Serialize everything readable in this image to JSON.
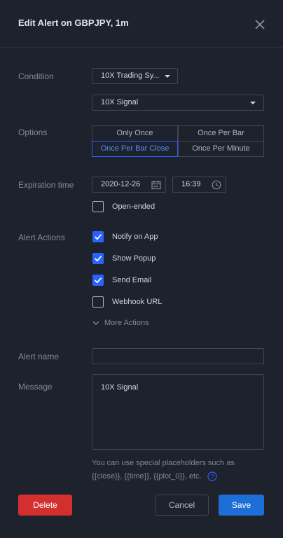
{
  "title": "Edit Alert on GBPJPY, 1m",
  "condition": {
    "label": "Condition",
    "indicator": "10X Trading Sy...",
    "signal": "10X Signal"
  },
  "options": {
    "label": "Options",
    "items": [
      "Only Once",
      "Once Per Bar",
      "Once Per Bar Close",
      "Once Per Minute"
    ],
    "selected": "Once Per Bar Close"
  },
  "expiration": {
    "label": "Expiration time",
    "date": "2020-12-26",
    "time": "16:39",
    "open_ended_label": "Open-ended",
    "open_ended": false
  },
  "alert_actions": {
    "label": "Alert Actions",
    "items": [
      {
        "label": "Notify on App",
        "checked": true
      },
      {
        "label": "Show Popup",
        "checked": true
      },
      {
        "label": "Send Email",
        "checked": true
      },
      {
        "label": "Webhook URL",
        "checked": false
      }
    ],
    "more_actions": "More Actions"
  },
  "alert_name": {
    "label": "Alert name",
    "value": ""
  },
  "message": {
    "label": "Message",
    "value": "10X Signal",
    "hint_line1": "You can use special placeholders such as",
    "hint_line2": "{{close}}, {{time}}, {{plot_0}}, etc."
  },
  "buttons": {
    "delete": "Delete",
    "cancel": "Cancel",
    "save": "Save"
  },
  "colors": {
    "background": "#1e222d",
    "accent": "#2962ff",
    "delete": "#d32f2f",
    "save": "#1e6ed8"
  }
}
